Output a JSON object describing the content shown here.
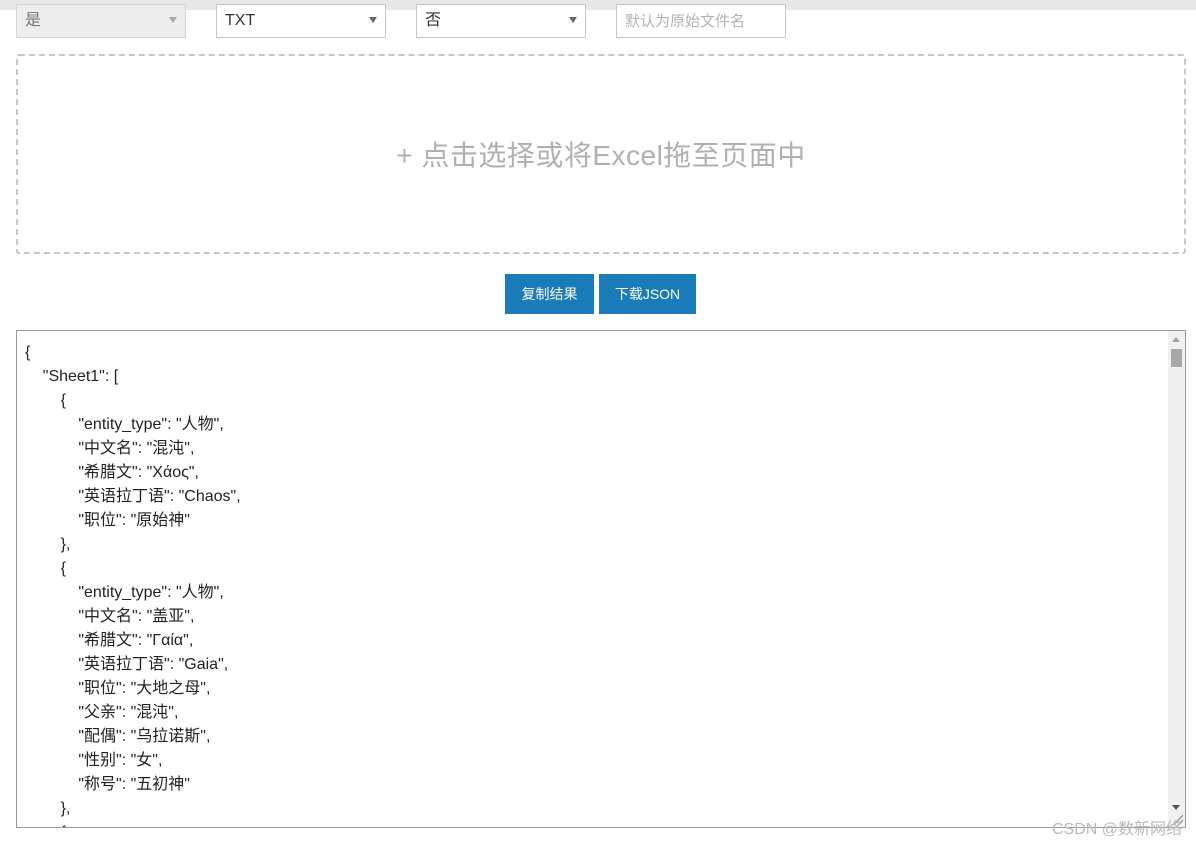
{
  "controls": {
    "select1": {
      "value": "是"
    },
    "select2": {
      "value": "TXT"
    },
    "select3": {
      "value": "否"
    },
    "filename": {
      "placeholder": "默认为原始文件名",
      "value": ""
    }
  },
  "dropzone": {
    "label": "+ 点击选择或将Excel拖至页面中"
  },
  "buttons": {
    "copy": "复制结果",
    "download": "下载JSON"
  },
  "output": {
    "lines": [
      "{",
      "    \"Sheet1\": [",
      "        {",
      "            \"entity_type\": \"人物\",",
      "            \"中文名\": \"混沌\",",
      "            \"希腊文\": \"Χάος\",",
      "            \"英语拉丁语\": \"Chaos\",",
      "            \"职位\": \"原始神\"",
      "        },",
      "        {",
      "            \"entity_type\": \"人物\",",
      "            \"中文名\": \"盖亚\",",
      "            \"希腊文\": \"Γαία\",",
      "            \"英语拉丁语\": \"Gaia\",",
      "            \"职位\": \"大地之母\",",
      "            \"父亲\": \"混沌\",",
      "            \"配偶\": \"乌拉诺斯\",",
      "            \"性别\": \"女\",",
      "            \"称号\": \"五初神\"",
      "        },",
      "        {"
    ]
  },
  "watermark": "CSDN @数新网络",
  "colors": {
    "button": "#1a7bb9",
    "dropzone_border": "#c6c6c6"
  }
}
